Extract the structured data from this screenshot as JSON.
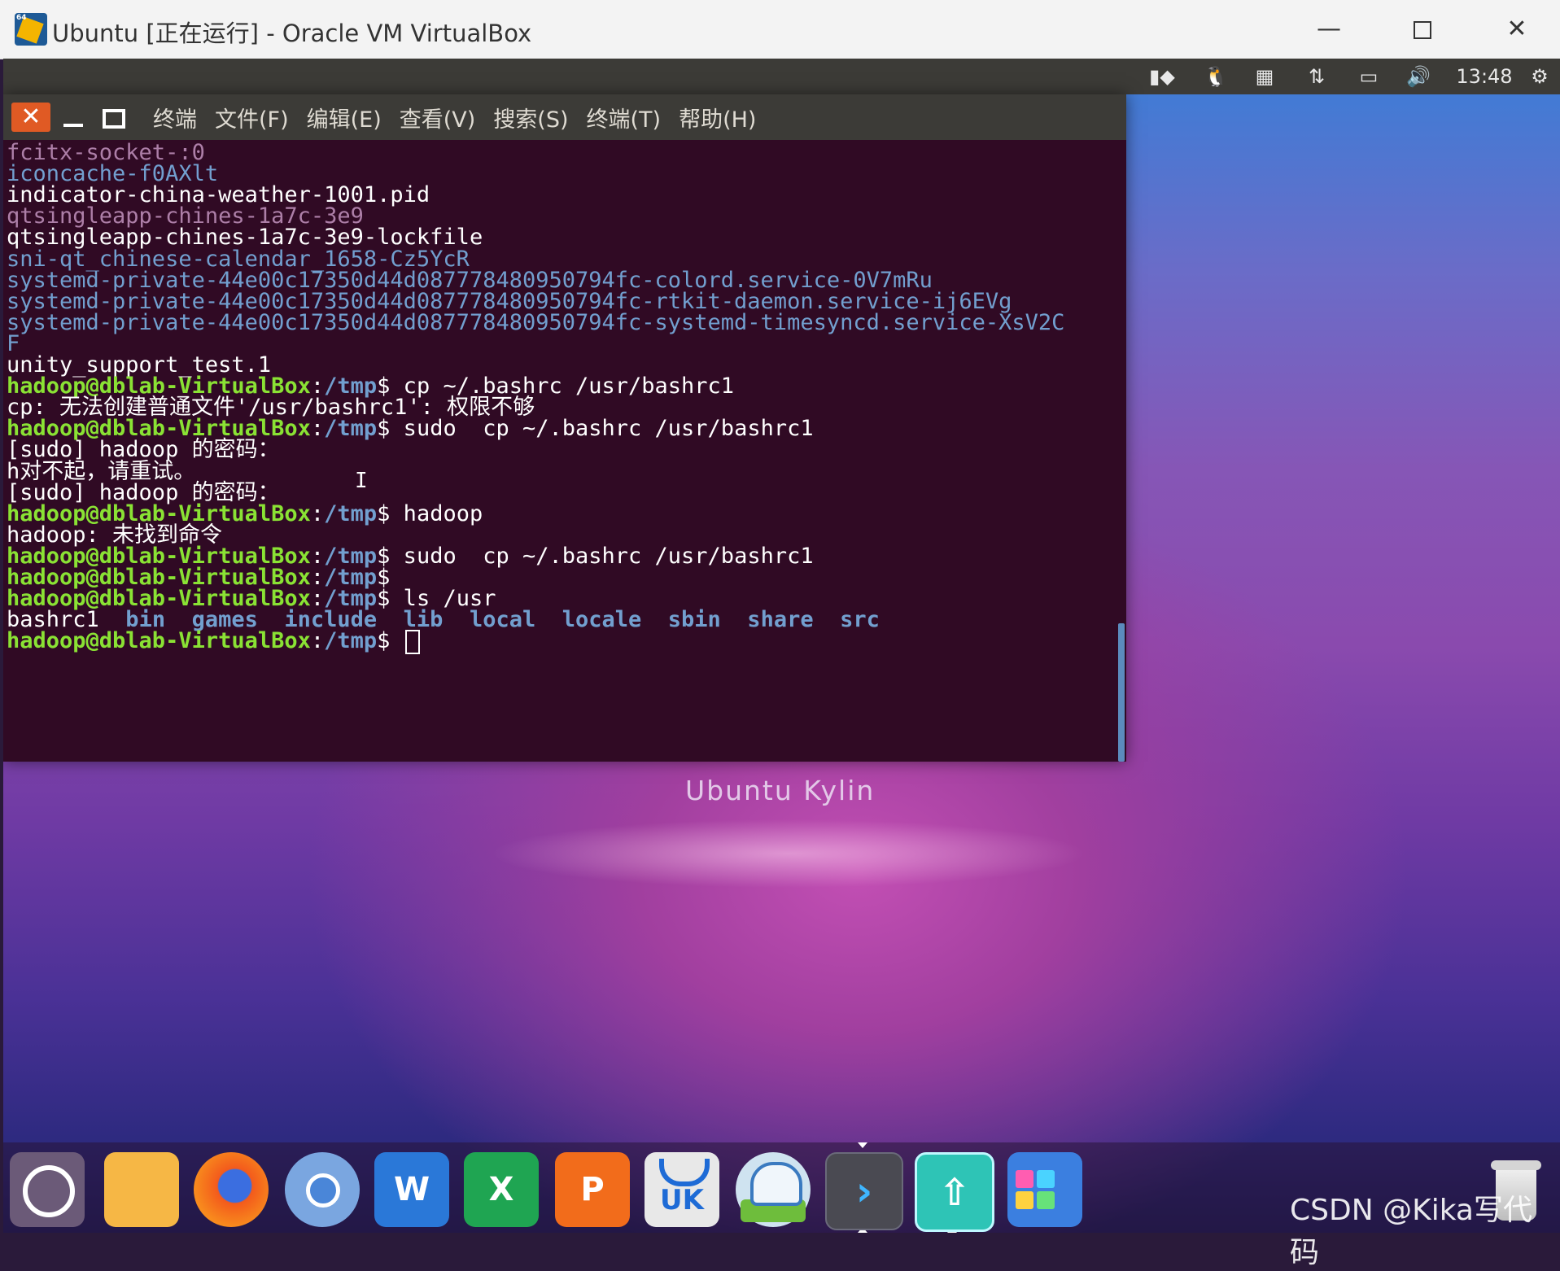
{
  "host_window": {
    "title": "Ubuntu [正在运行] - Oracle VM VirtualBox",
    "app_icon_text": "64",
    "minimize_glyph": "—",
    "close_glyph": "✕"
  },
  "unity_panel": {
    "clock": "13:48",
    "icons": [
      "keyboard-indicator-icon",
      "penguin-icon",
      "calendar-icon",
      "network-icon",
      "battery-icon",
      "volume-icon",
      "gear-icon"
    ]
  },
  "terminal": {
    "menus": [
      "终端",
      "文件(F)",
      "编辑(E)",
      "查看(V)",
      "搜索(S)",
      "终端(T)",
      "帮助(H)"
    ],
    "close_glyph": "✕",
    "lines": [
      [
        {
          "text": "fcitx-socket-:0",
          "c": "c-purple"
        }
      ],
      [
        {
          "text": "iconcache-f0AXlt",
          "c": "c-blue"
        }
      ],
      [
        {
          "text": "indicator-china-weather-1001.pid",
          "c": "c-white"
        }
      ],
      [
        {
          "text": "qtsingleapp-chines-1a7c-3e9",
          "c": "c-purple"
        }
      ],
      [
        {
          "text": "qtsingleapp-chines-1a7c-3e9-lockfile",
          "c": "c-white"
        }
      ],
      [
        {
          "text": "sni-qt_chinese-calendar_1658-Cz5YcR",
          "c": "c-blue"
        }
      ],
      [
        {
          "text": "systemd-private-44e00c17350d44d087778480950794fc-colord.service-0V7mRu",
          "c": "c-blue"
        }
      ],
      [
        {
          "text": "systemd-private-44e00c17350d44d087778480950794fc-rtkit-daemon.service-ij6EVg",
          "c": "c-blue"
        }
      ],
      [
        {
          "text": "systemd-private-44e00c17350d44d087778480950794fc-systemd-timesyncd.service-XsV2C",
          "c": "c-blue"
        }
      ],
      [
        {
          "text": "F",
          "c": "c-blue"
        }
      ],
      [
        {
          "text": "unity_support_test.1",
          "c": "c-white"
        }
      ],
      [
        {
          "text": "hadoop@dblab-VirtualBox",
          "c": "c-green"
        },
        {
          "text": ":",
          "c": "c-white"
        },
        {
          "text": "/tmp",
          "c": "c-blueb"
        },
        {
          "text": "$ cp ~/.bashrc /usr/bashrc1",
          "c": "c-white"
        }
      ],
      [
        {
          "text": "cp: 无法创建普通文件'/usr/bashrc1': 权限不够",
          "c": "c-white"
        }
      ],
      [
        {
          "text": "hadoop@dblab-VirtualBox",
          "c": "c-green"
        },
        {
          "text": ":",
          "c": "c-white"
        },
        {
          "text": "/tmp",
          "c": "c-blueb"
        },
        {
          "text": "$ sudo  cp ~/.bashrc /usr/bashrc1",
          "c": "c-white"
        }
      ],
      [
        {
          "text": "[sudo] hadoop 的密码：",
          "c": "c-white"
        }
      ],
      [
        {
          "text": "h对不起，请重试。",
          "c": "c-white"
        }
      ],
      [
        {
          "text": "[sudo] hadoop 的密码：",
          "c": "c-white"
        }
      ],
      [
        {
          "text": "hadoop@dblab-VirtualBox",
          "c": "c-green"
        },
        {
          "text": ":",
          "c": "c-white"
        },
        {
          "text": "/tmp",
          "c": "c-blueb"
        },
        {
          "text": "$ hadoop",
          "c": "c-white"
        }
      ],
      [
        {
          "text": "hadoop: 未找到命令",
          "c": "c-white"
        }
      ],
      [
        {
          "text": "hadoop@dblab-VirtualBox",
          "c": "c-green"
        },
        {
          "text": ":",
          "c": "c-white"
        },
        {
          "text": "/tmp",
          "c": "c-blueb"
        },
        {
          "text": "$ sudo  cp ~/.bashrc /usr/bashrc1",
          "c": "c-white"
        }
      ],
      [
        {
          "text": "hadoop@dblab-VirtualBox",
          "c": "c-green"
        },
        {
          "text": ":",
          "c": "c-white"
        },
        {
          "text": "/tmp",
          "c": "c-blueb"
        },
        {
          "text": "$",
          "c": "c-white"
        }
      ],
      [
        {
          "text": "hadoop@dblab-VirtualBox",
          "c": "c-green"
        },
        {
          "text": ":",
          "c": "c-white"
        },
        {
          "text": "/tmp",
          "c": "c-blueb"
        },
        {
          "text": "$ ls /usr",
          "c": "c-white"
        }
      ],
      [
        {
          "text": "bashrc1",
          "c": "c-white"
        },
        {
          "text": "  bin  games  include  lib  local  locale  sbin  share  src",
          "c": "c-blueb"
        }
      ],
      [
        {
          "text": "hadoop@dblab-VirtualBox",
          "c": "c-green"
        },
        {
          "text": ":",
          "c": "c-white"
        },
        {
          "text": "/tmp",
          "c": "c-blueb"
        },
        {
          "text": "$ ",
          "c": "c-white"
        }
      ]
    ]
  },
  "desktop": {
    "wallpaper_label": "Ubuntu Kylin"
  },
  "dock": {
    "items": [
      "ubuntu-logo-icon",
      "files-icon",
      "firefox-icon",
      "chromium-icon",
      "word-icon",
      "excel-icon",
      "powerpoint-icon",
      "software-center-icon",
      "kylin-assistant-icon",
      "terminal-icon",
      "update-manager-icon",
      "workspace-icon",
      "trash-icon"
    ],
    "word_letter": "W",
    "excel_letter": "X",
    "ppt_letter": "P",
    "uk_label": "UK",
    "term_glyph": "›",
    "update_glyph": "⇧"
  },
  "watermark": "CSDN @Kika写代码"
}
